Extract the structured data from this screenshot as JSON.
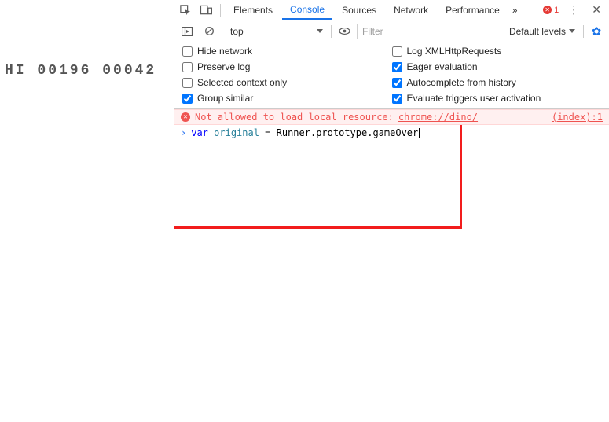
{
  "page": {
    "hiscore": "HI 00196 00042"
  },
  "tabs": {
    "elements": "Elements",
    "console": "Console",
    "sources": "Sources",
    "network": "Network",
    "performance": "Performance"
  },
  "topbar": {
    "error_count": "1",
    "more_glyph": "»"
  },
  "toolbar": {
    "context": "top",
    "filter_placeholder": "Filter",
    "levels_label": "Default levels"
  },
  "settings": {
    "hide_network": "Hide network",
    "log_xhr": "Log XMLHttpRequests",
    "preserve_log": "Preserve log",
    "eager_eval": "Eager evaluation",
    "selected_ctx": "Selected context only",
    "autocomplete": "Autocomplete from history",
    "group_similar": "Group similar",
    "eval_triggers": "Evaluate triggers user activation",
    "checked": {
      "hide_network": false,
      "log_xhr": false,
      "preserve_log": false,
      "eager_eval": true,
      "selected_ctx": false,
      "autocomplete": true,
      "group_similar": true,
      "eval_triggers": true
    }
  },
  "console": {
    "error": {
      "prefix": "Not allowed to load local resource: ",
      "link": "chrome://dino/",
      "source": "(index):1"
    },
    "input": {
      "kw": "var",
      "varname": "original",
      "rest": " = Runner.prototype.gameOver"
    }
  }
}
